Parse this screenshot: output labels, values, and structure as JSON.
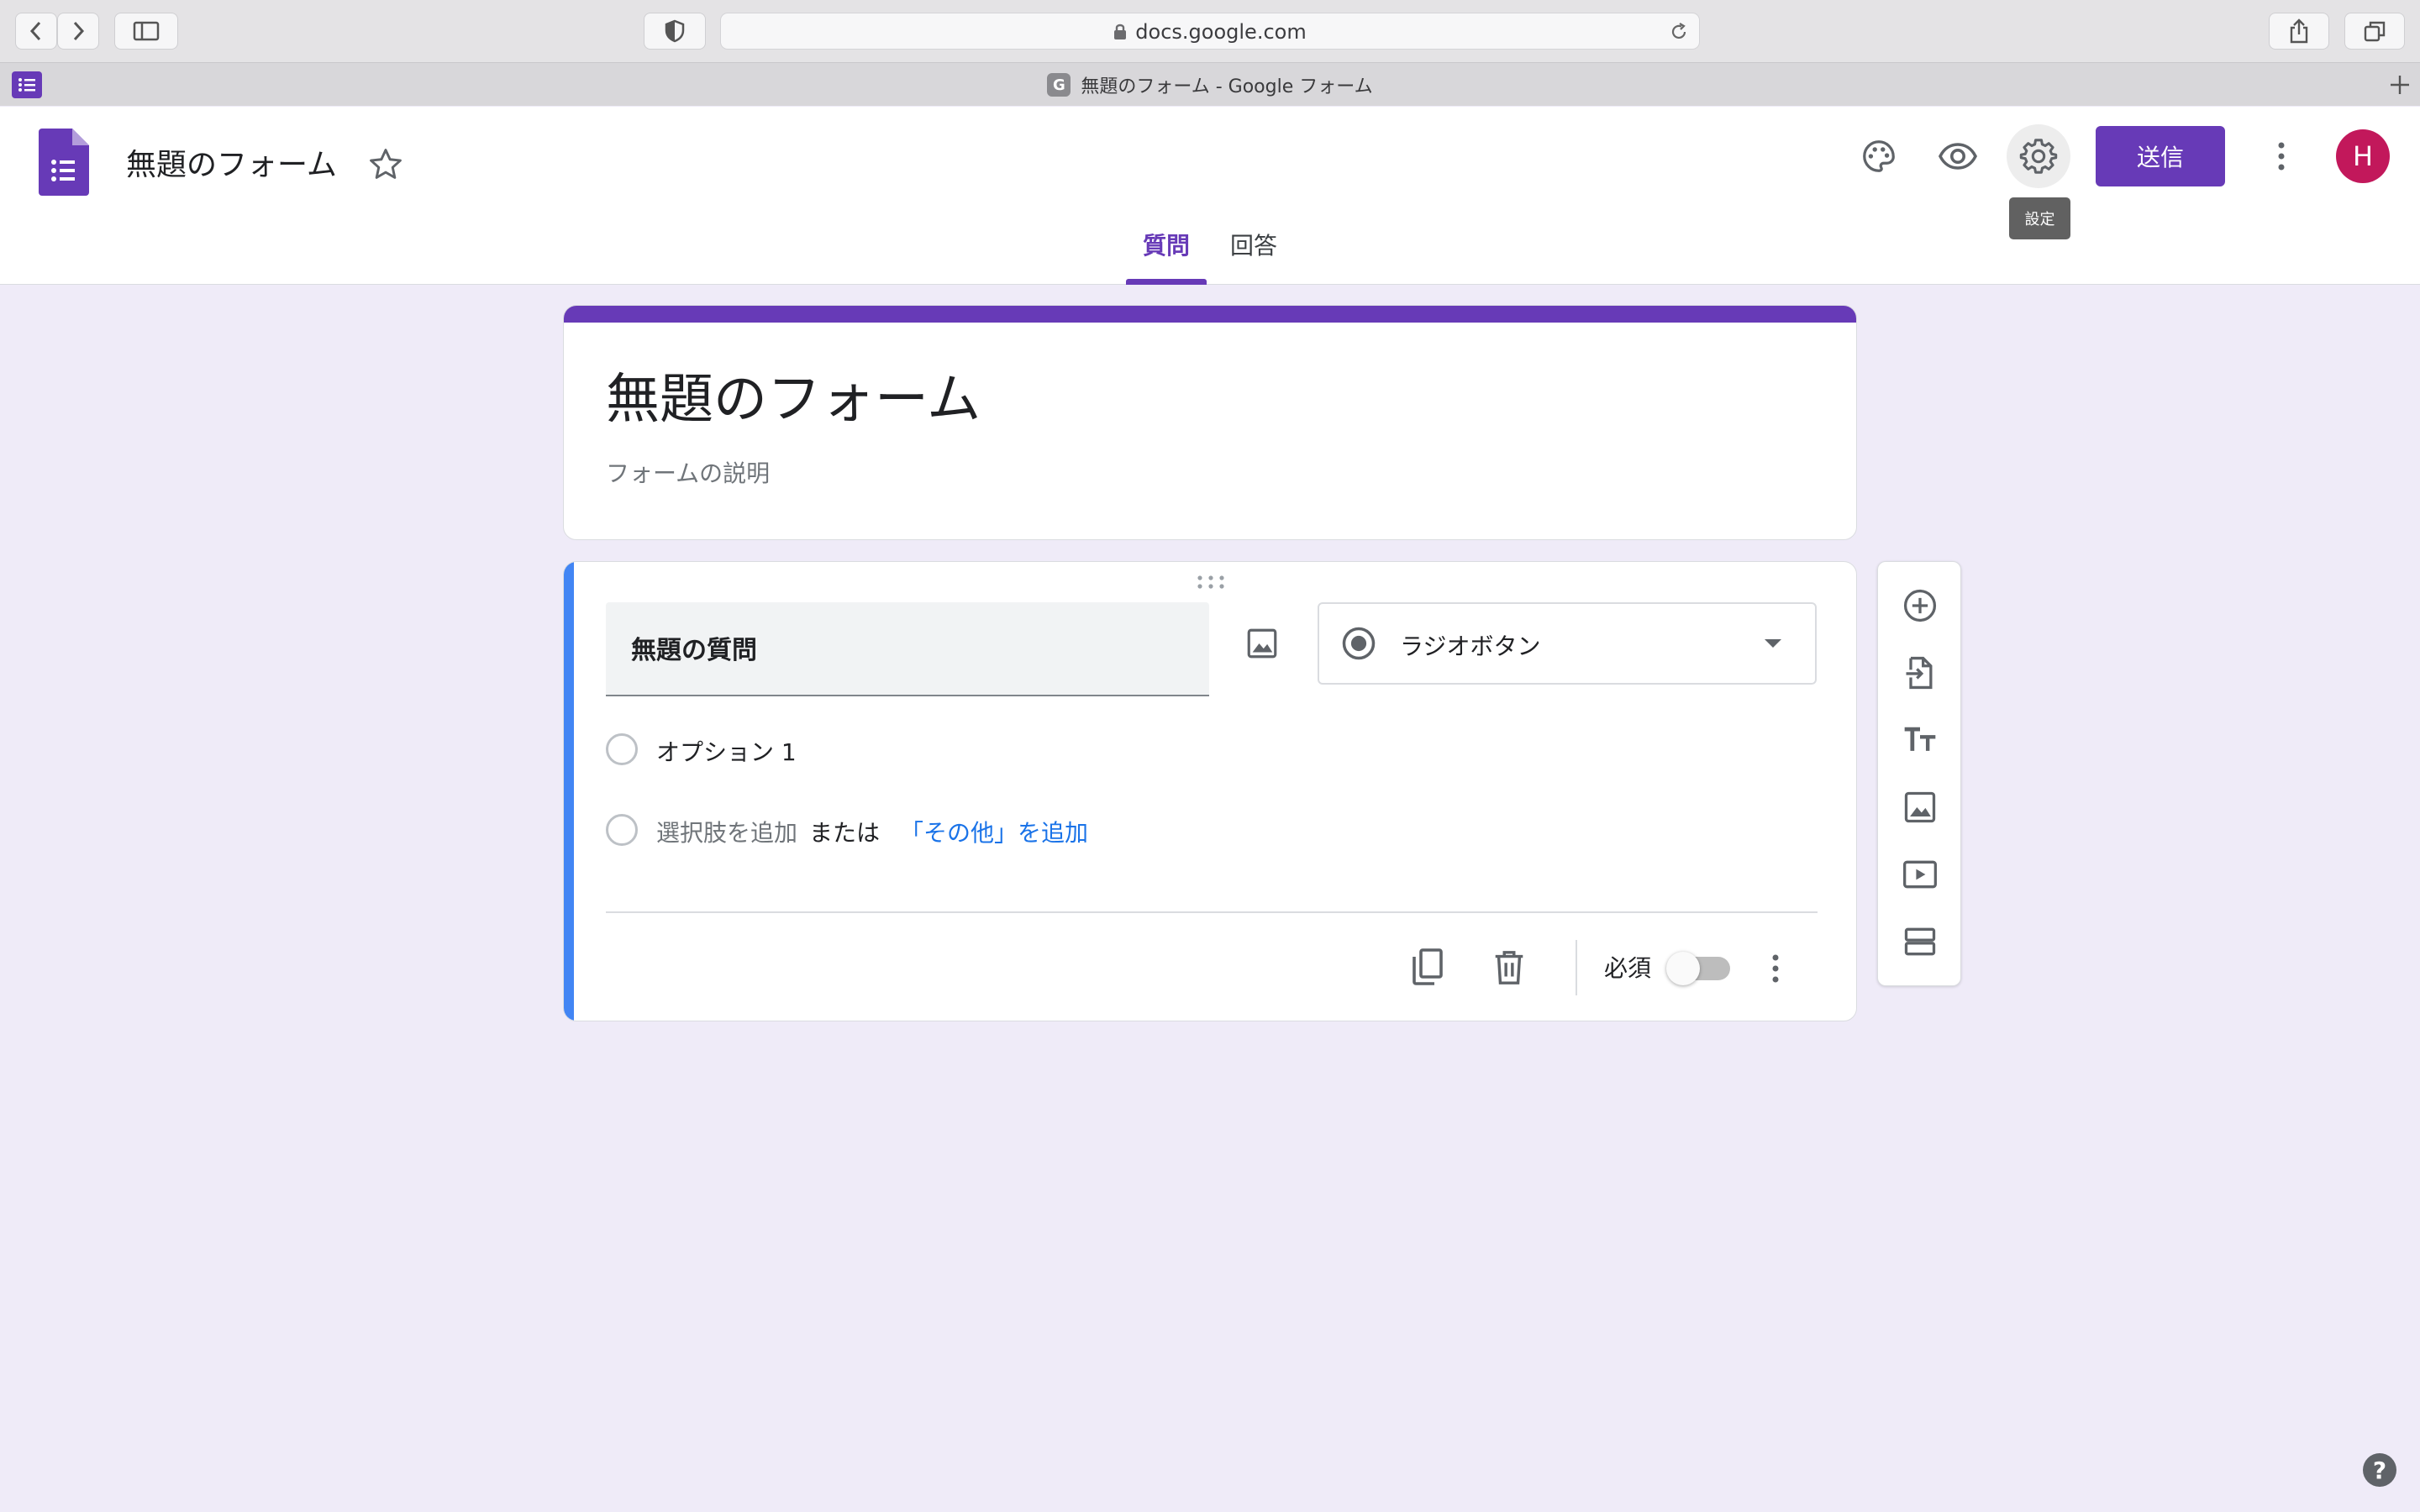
{
  "browser": {
    "url": "docs.google.com",
    "tab_title": "無題のフォーム - Google フォーム",
    "favicon_letter": "G"
  },
  "header": {
    "form_name": "無題のフォーム",
    "send_label": "送信",
    "avatar_letter": "H",
    "tooltip": "設定",
    "tabs": [
      {
        "label": "質問",
        "active": true
      },
      {
        "label": "回答",
        "active": false
      }
    ]
  },
  "form": {
    "title": "無題のフォーム",
    "description_placeholder": "フォームの説明"
  },
  "question": {
    "title": "無題の質問",
    "type": "ラジオボタン",
    "options": [
      "オプション 1"
    ],
    "add_option": "選択肢を追加",
    "or_text": "または",
    "add_other": "「その他」を追加",
    "required_label": "必須",
    "required": false
  },
  "side_toolbar": [
    "add-question-icon",
    "import-questions-icon",
    "title-text-icon",
    "image-icon",
    "video-icon",
    "section-icon"
  ],
  "colors": {
    "accent": "#673ab7",
    "background": "#efebf8",
    "question_accent": "#4285f4",
    "avatar": "#c2185b",
    "link": "#1a73e8"
  }
}
